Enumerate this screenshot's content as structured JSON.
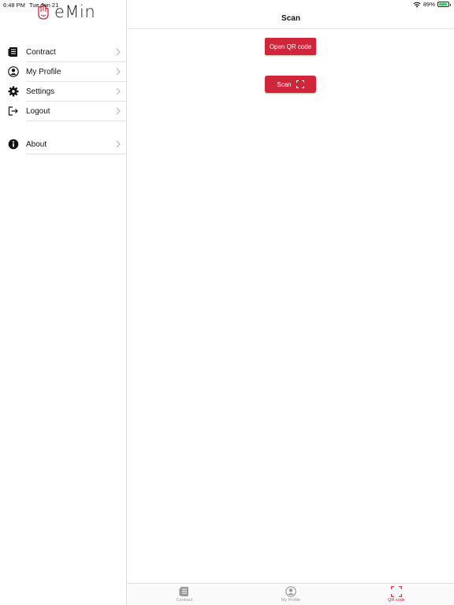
{
  "status_bar": {
    "time": "6:48 PM",
    "date": "Tue Jun 21",
    "battery": "89%",
    "battery_level": 0.89
  },
  "app": {
    "logo_text": "eMin",
    "brand_color": "#d0263a"
  },
  "sidebar": {
    "items": [
      {
        "label": "Contract",
        "icon": "document-icon"
      },
      {
        "label": "My Profile",
        "icon": "user-icon"
      },
      {
        "label": "Settings",
        "icon": "gear-icon"
      },
      {
        "label": "Logout",
        "icon": "logout-icon"
      }
    ],
    "about": {
      "label": "About",
      "icon": "info-icon"
    }
  },
  "main": {
    "title": "Scan",
    "open_button_label": "Open QR code",
    "scan_button_label": "Scan"
  },
  "tabbar": {
    "tabs": [
      {
        "label": "Contract",
        "icon": "document-icon",
        "active": false
      },
      {
        "label": "My Profile",
        "icon": "user-icon",
        "active": false
      },
      {
        "label": "QR code",
        "icon": "qr-scan-icon",
        "active": true
      }
    ]
  }
}
